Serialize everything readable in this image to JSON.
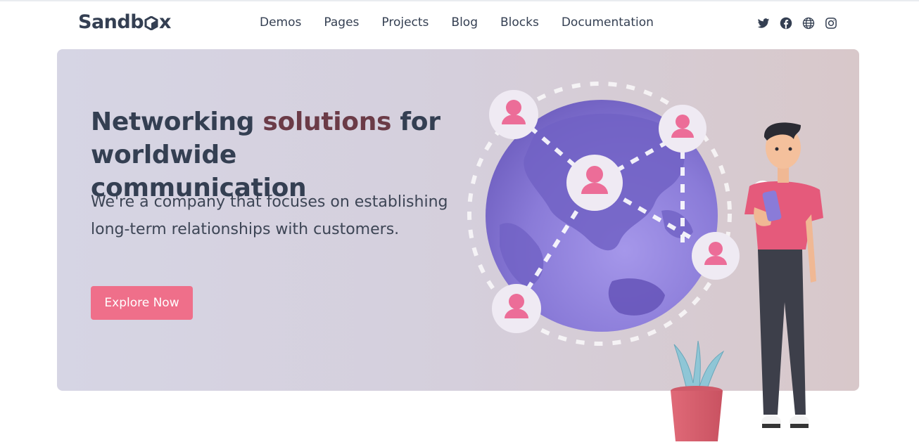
{
  "brand": {
    "name_part1": "Sandb",
    "name_part2": "x"
  },
  "nav": {
    "items": [
      "Demos",
      "Pages",
      "Projects",
      "Blog",
      "Blocks",
      "Documentation"
    ]
  },
  "socials": [
    "twitter-icon",
    "facebook-icon",
    "globe-icon",
    "instagram-icon"
  ],
  "hero": {
    "title_part1": "Networking ",
    "title_accent": "solutions",
    "title_part2": " for worldwide communication",
    "subtitle": "We're a company that focuses on establishing long-term relationships with customers.",
    "cta_label": "Explore Now"
  },
  "colors": {
    "accent": "#ef6f8a",
    "title_accent": "#6b3b47",
    "text": "#343f52",
    "globe": "#8a7bd8"
  }
}
